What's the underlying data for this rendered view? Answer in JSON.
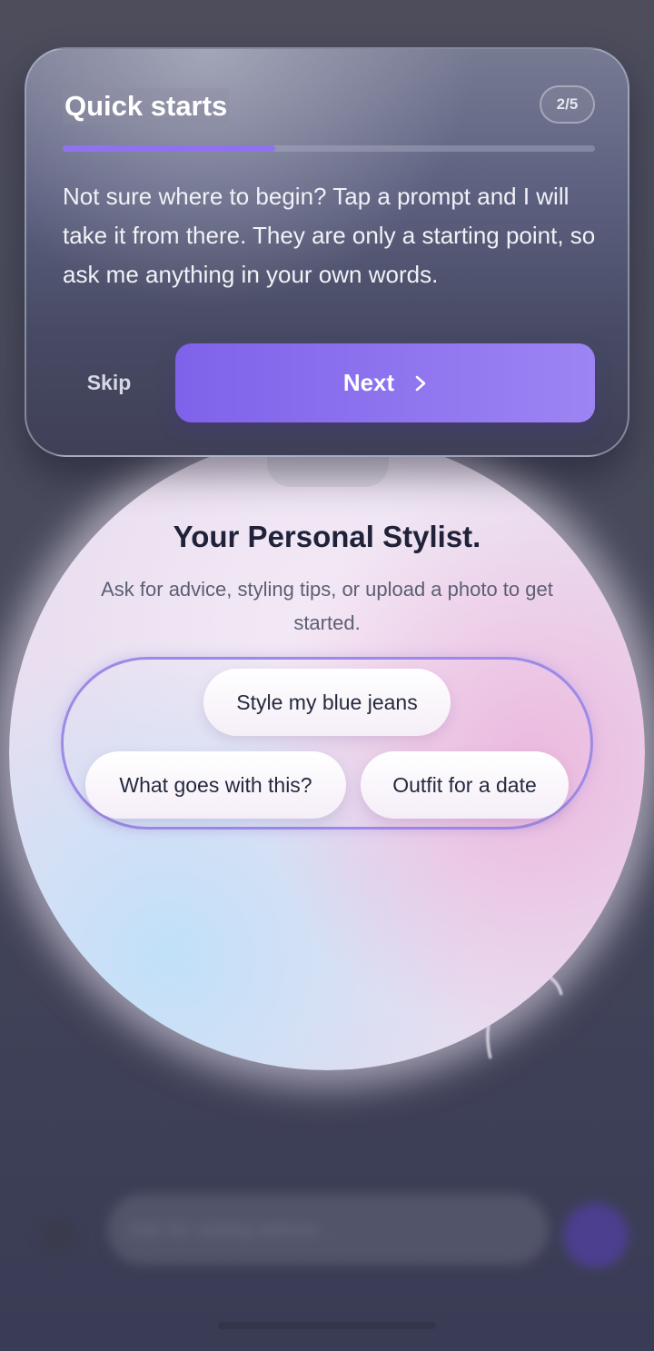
{
  "tour": {
    "title": "Quick starts",
    "step": "2/5",
    "progress": 0.4,
    "body": "Not sure where to begin? Tap a prompt and I will take it from there. They are only a starting point, so ask me anything in your own words.",
    "skip_label": "Skip",
    "next_label": "Next",
    "next_icon": "chevron-right-icon"
  },
  "hero": {
    "title": "Your Personal Stylist.",
    "subtitle": "Ask for advice, styling tips, or upload a photo to get started."
  },
  "quick_starts": [
    "Style my blue jeans",
    "What goes with this?",
    "Outfit for a date"
  ],
  "composer": {
    "placeholder": "Ask for styling advice...",
    "attach_icon": "plus-icon",
    "send_icon": "send-icon"
  },
  "colors": {
    "accent": "#8f72ee",
    "overlay": "#474a5c",
    "ring": "#9d8ae6"
  }
}
